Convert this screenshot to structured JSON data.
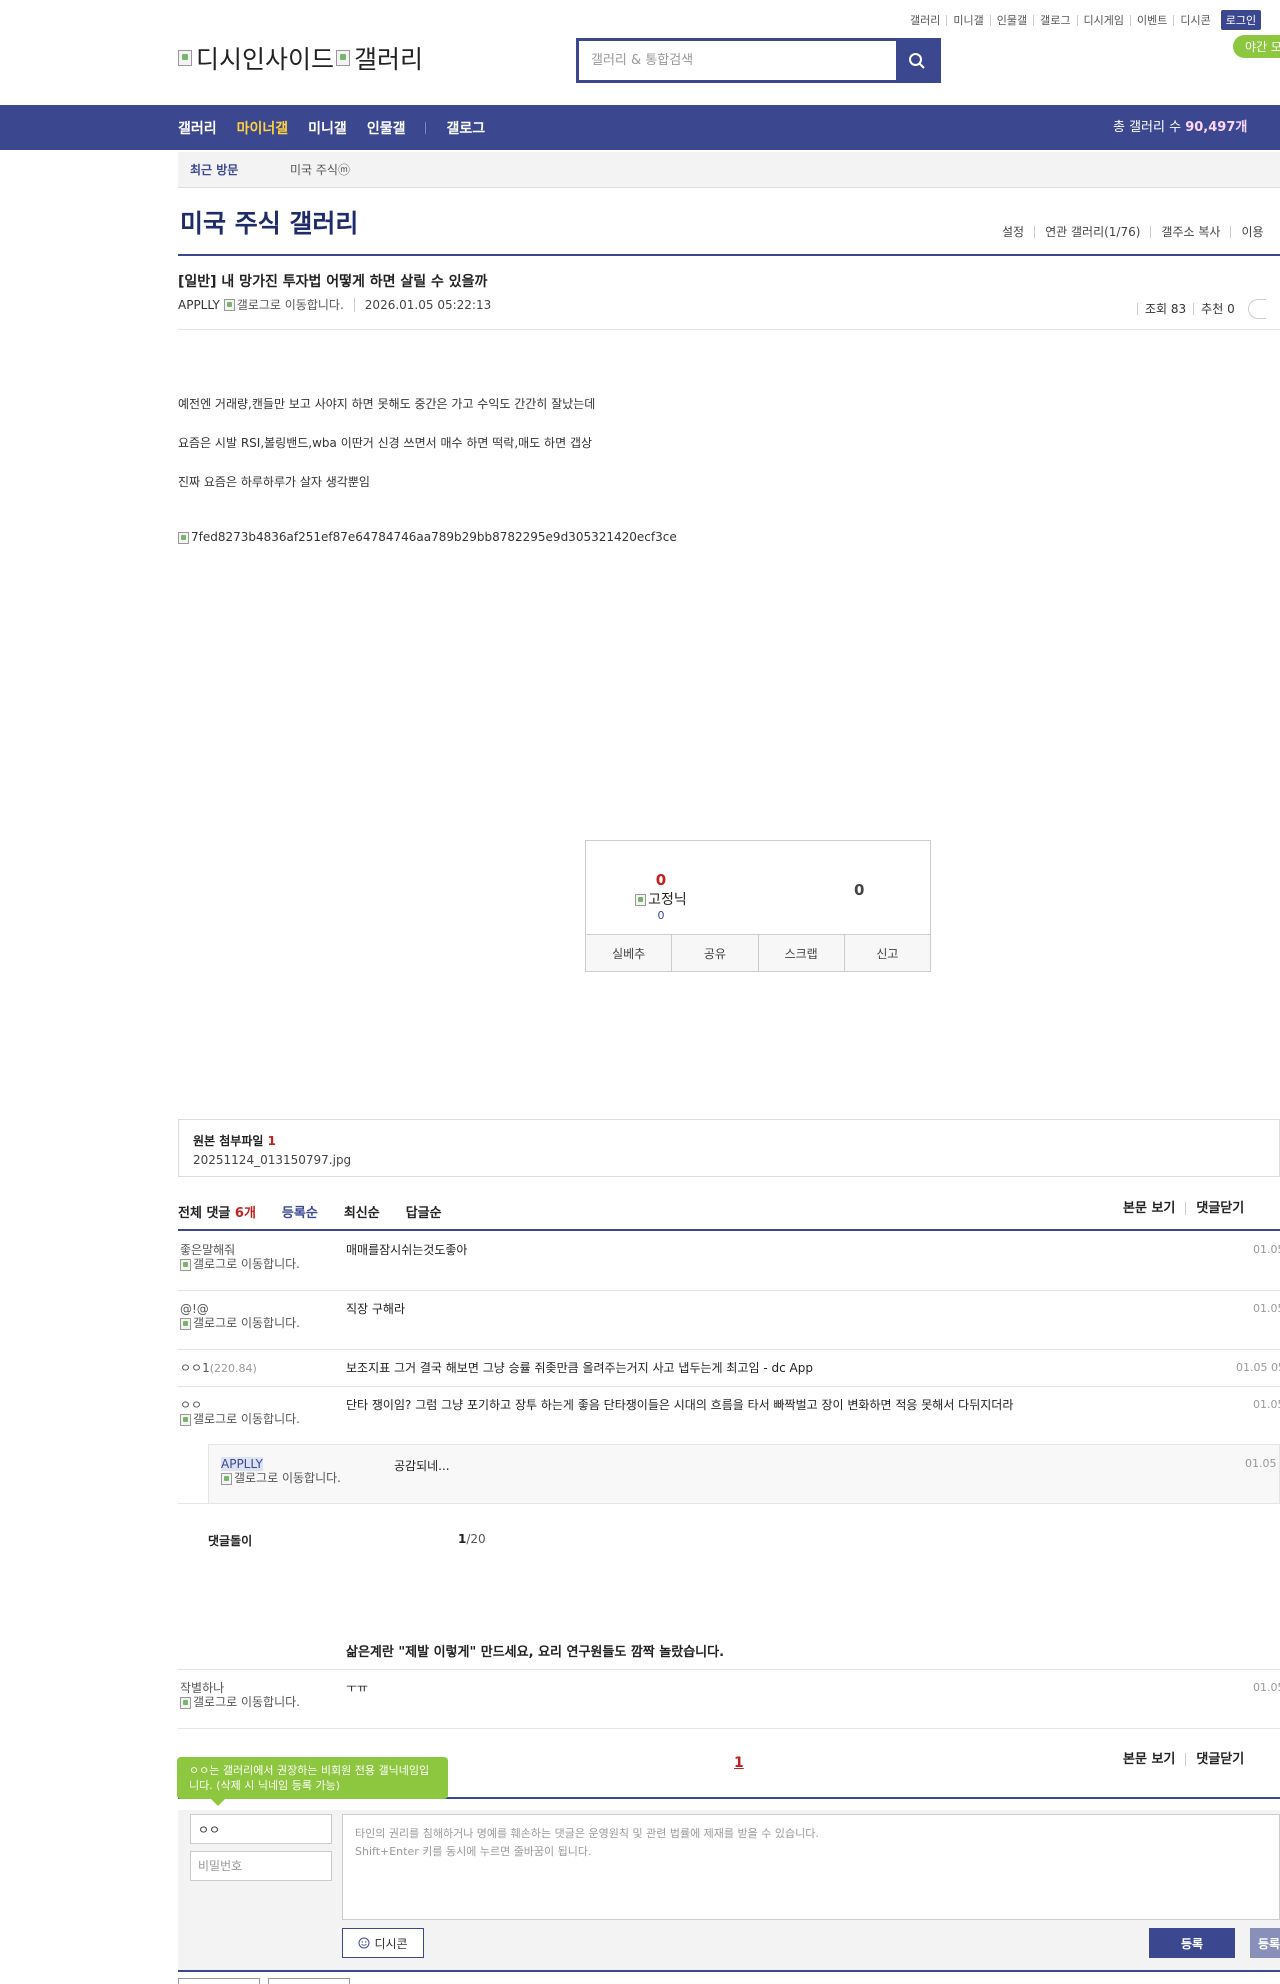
{
  "util": {
    "links": [
      "갤러리",
      "미니갤",
      "인물갤",
      "갤로그",
      "디시게임",
      "이벤트",
      "디시콘"
    ],
    "login": "로그인",
    "night": "야간 모"
  },
  "logo": {
    "alt1": "디시인사이드",
    "alt2": "갤러리"
  },
  "search": {
    "placeholder": "갤러리 & 통합검색"
  },
  "nav": {
    "items": [
      "갤러리",
      "마이너갤",
      "미니갤",
      "인물갤",
      "갤로그"
    ],
    "total_label": "총 갤러리 수",
    "total_value": "90,497개"
  },
  "recent": {
    "label": "최근 방문",
    "value": "미국 주식ⓜ"
  },
  "gallery": {
    "title": "미국 주식 갤러리",
    "links": [
      "설정",
      "연관 갤러리(1/76)",
      "갤주소 복사",
      "이용"
    ]
  },
  "post": {
    "title": "[일반] 내 망가진 투자법 어떻게 하면 살릴 수 있을까",
    "author": "APPLLY",
    "author_img_alt": "갤로그로 이동합니다.",
    "date": "2026.01.05 05:22:13",
    "views": "조회 83",
    "recommend": "추천 0",
    "body": [
      "예전엔 거래량,캔들만 보고 사야지 하면 못해도 중간은 가고 수익도 간간히 잘났는데",
      "요즘은 시발 RSI,볼링밴드,wba 이딴거 신경 쓰면서 매수 하면 떡락,매도 하면 갭상",
      "진짜 요즘은 하루하루가 살자 생각뿐임"
    ],
    "image_alt": "7fed8273b4836af251ef87e64784746aa789b29bb8782295e9d305321420ecf3ce"
  },
  "recommend_box": {
    "up": "0",
    "fixed_alt": "고정닉",
    "fixed_count": "0",
    "down": "0",
    "buttons": [
      "실베추",
      "공유",
      "스크랩",
      "신고"
    ]
  },
  "attachment": {
    "label": "원본 첨부파일",
    "count": "1",
    "file": "20251124_013150797.jpg"
  },
  "comments_header": {
    "total_label": "전체 댓글",
    "total_count": "6개",
    "sorts": [
      "등록순",
      "최신순",
      "답글순"
    ],
    "actions": [
      "본문 보기",
      "댓글닫기"
    ]
  },
  "comments": [
    {
      "nick": "좋은말해줘",
      "alt": "갤로그로 이동합니다.",
      "text": "매매를잠시쉬는것도좋아",
      "date": "01.05"
    },
    {
      "nick": "@!@",
      "alt": "갤로그로 이동합니다.",
      "text": "직장 구해라",
      "date": "01.05"
    },
    {
      "nick": "ㅇㅇ1",
      "ip": "(220.84)",
      "text": "보조지표 그거 결국 해보면 그냥 승률 쥐좆만큼 올려주는거지 사고 냅두는게 최고임 - dc App",
      "date": "01.05 05"
    },
    {
      "nick": "ㅇㅇ",
      "alt": "갤로그로 이동합니다.",
      "text": "단타 쟁이임? 그럼 그냥 포기하고 장투 하는게 좋음 단타쟁이들은 시대의 흐름을 타서 빠짝벌고 장이 변화하면 적응 못해서 다뒤지더라",
      "date": "01.05"
    }
  ],
  "reply": {
    "nick": "APPLLY",
    "alt": "갤로그로 이동합니다.",
    "text": "공감되네...",
    "date": "01.05 0"
  },
  "comment_pager": {
    "label": "댓글돌이",
    "current": "1",
    "total": "/20"
  },
  "ad_text": "삶은계란 \"제발 이렇게\" 만드세요, 요리 연구원들도 깜짝 놀랐습니다.",
  "last_comment": {
    "nick": "작별하나",
    "alt": "갤로그로 이동합니다.",
    "text": "ㅜㅠ",
    "date": "01.05"
  },
  "page_number": "1",
  "tooltip": "ㅇㅇ는 갤러리에서 권장하는 비회원 전용 갤닉네임입니다. (삭제 시 닉네임 등록 가능)",
  "write": {
    "nick_value": "ㅇㅇ",
    "password_placeholder": "비밀번호",
    "textarea_placeholder": "타인의 권리를 침해하거나 명예를 훼손하는 댓글은 운영원칙 및 관련 법률에 제재를 받을 수 있습니다.\nShift+Enter 키를 동시에 누르면 줄바꿈이 됩니다.",
    "dccon": "디시콘",
    "submit": "등록",
    "submit2": "등록"
  }
}
